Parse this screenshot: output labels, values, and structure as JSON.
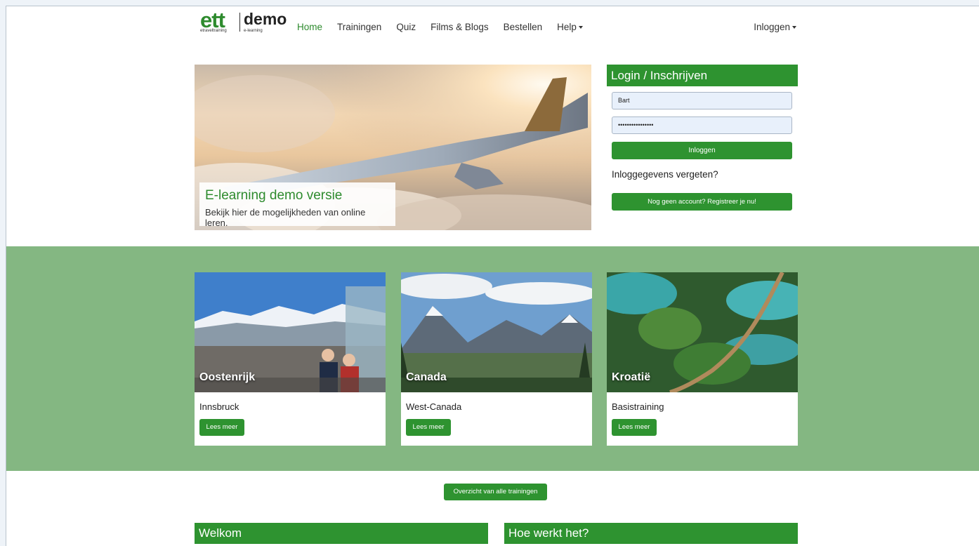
{
  "logo": {
    "brand": "ett",
    "product": "demo",
    "brand_sub": "etraveltraining",
    "product_sub": "e-learning"
  },
  "nav": {
    "items": [
      {
        "label": "Home",
        "active": true
      },
      {
        "label": "Trainingen"
      },
      {
        "label": "Quiz"
      },
      {
        "label": "Films & Blogs"
      },
      {
        "label": "Bestellen"
      },
      {
        "label": "Help",
        "dropdown": true
      }
    ],
    "login_label": "Inloggen"
  },
  "hero": {
    "title": "E-learning demo versie",
    "subtitle": "Bekijk hier de mogelijkheden van online leren."
  },
  "login": {
    "title": "Login / Inschrijven",
    "username": "Bart",
    "password": "••••••••••••••••",
    "submit_label": "Inloggen",
    "forgot_label": "Inloggegevens vergeten?",
    "register_label": "Nog geen account? Registreer je nu!"
  },
  "cards": [
    {
      "label": "Oostenrijk",
      "subtitle": "Innsbruck",
      "button": "Lees meer"
    },
    {
      "label": "Canada",
      "subtitle": "West-Canada",
      "button": "Lees meer"
    },
    {
      "label": "Kroatië",
      "subtitle": "Basistraining",
      "button": "Lees meer"
    }
  ],
  "overview_button": "Overzicht van alle trainingen",
  "sections": {
    "welcome": "Welkom",
    "how": "Hoe werkt het?"
  },
  "colors": {
    "brand_green": "#2e9330",
    "band_green": "#84b782"
  }
}
